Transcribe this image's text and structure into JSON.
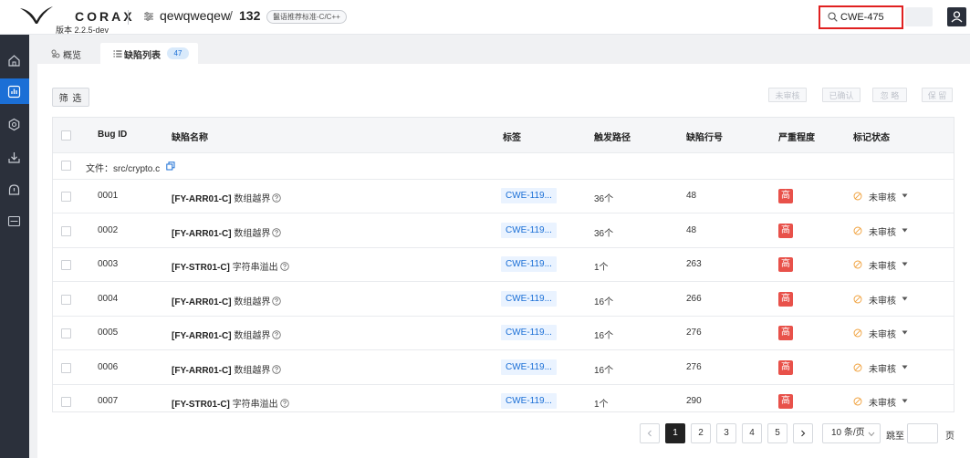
{
  "app": {
    "logo_text": "CORAX",
    "version": "版本 2.2.5-dev"
  },
  "project": {
    "name": "qewqweqew",
    "separator": "/",
    "number": "132",
    "standard_badge": "鬣语推荐标准-C/C++"
  },
  "search": {
    "value": "CWE-475"
  },
  "tabs": [
    {
      "label": "概览"
    },
    {
      "label": "缺陷列表",
      "count": "47"
    }
  ],
  "toolbar": {
    "filter_label": "筛 选",
    "actions": [
      "未审核",
      "已确认",
      "忽 略",
      "保 留"
    ]
  },
  "table": {
    "columns": [
      "Bug ID",
      "缺陷名称",
      "标签",
      "触发路径",
      "缺陷行号",
      "严重程度",
      "标记状态"
    ],
    "file_label": "文件：src/crypto.c",
    "rows": [
      {
        "id": "0001",
        "rule": "[FY-ARR01-C]",
        "desc": "数组越界",
        "tag": "CWE-119...",
        "path": "36个",
        "line": "48",
        "severity": "高",
        "status": "未审核"
      },
      {
        "id": "0002",
        "rule": "[FY-ARR01-C]",
        "desc": "数组越界",
        "tag": "CWE-119...",
        "path": "36个",
        "line": "48",
        "severity": "高",
        "status": "未审核"
      },
      {
        "id": "0003",
        "rule": "[FY-STR01-C]",
        "desc": "字符串溢出",
        "tag": "CWE-119...",
        "path": "1个",
        "line": "263",
        "severity": "高",
        "status": "未审核"
      },
      {
        "id": "0004",
        "rule": "[FY-ARR01-C]",
        "desc": "数组越界",
        "tag": "CWE-119...",
        "path": "16个",
        "line": "266",
        "severity": "高",
        "status": "未审核"
      },
      {
        "id": "0005",
        "rule": "[FY-ARR01-C]",
        "desc": "数组越界",
        "tag": "CWE-119...",
        "path": "16个",
        "line": "276",
        "severity": "高",
        "status": "未审核"
      },
      {
        "id": "0006",
        "rule": "[FY-ARR01-C]",
        "desc": "数组越界",
        "tag": "CWE-119...",
        "path": "16个",
        "line": "276",
        "severity": "高",
        "status": "未审核"
      },
      {
        "id": "0007",
        "rule": "[FY-STR01-C]",
        "desc": "字符串溢出",
        "tag": "CWE-119...",
        "path": "1个",
        "line": "290",
        "severity": "高",
        "status": "未审核"
      }
    ]
  },
  "pagination": {
    "pages": [
      "1",
      "2",
      "3",
      "4",
      "5"
    ],
    "current": "1",
    "page_size": "10 条/页",
    "goto_label": "跳至",
    "goto_unit": "页"
  },
  "colors": {
    "accent": "#1b6fd6",
    "nav_bg": "#2b303b",
    "severity_high": "#e8514a",
    "search_highlight": "#e02020"
  },
  "icons": {
    "logo": "corax-wing-logo",
    "project": "sliders-icon",
    "search": "search-icon",
    "user": "user-icon",
    "nav": [
      "home-icon",
      "chart-icon",
      "settings-icon",
      "download-icon",
      "alert-icon",
      "terminal-icon"
    ],
    "copy": "copy-icon",
    "help": "help-icon",
    "status": "eye-off-icon"
  }
}
